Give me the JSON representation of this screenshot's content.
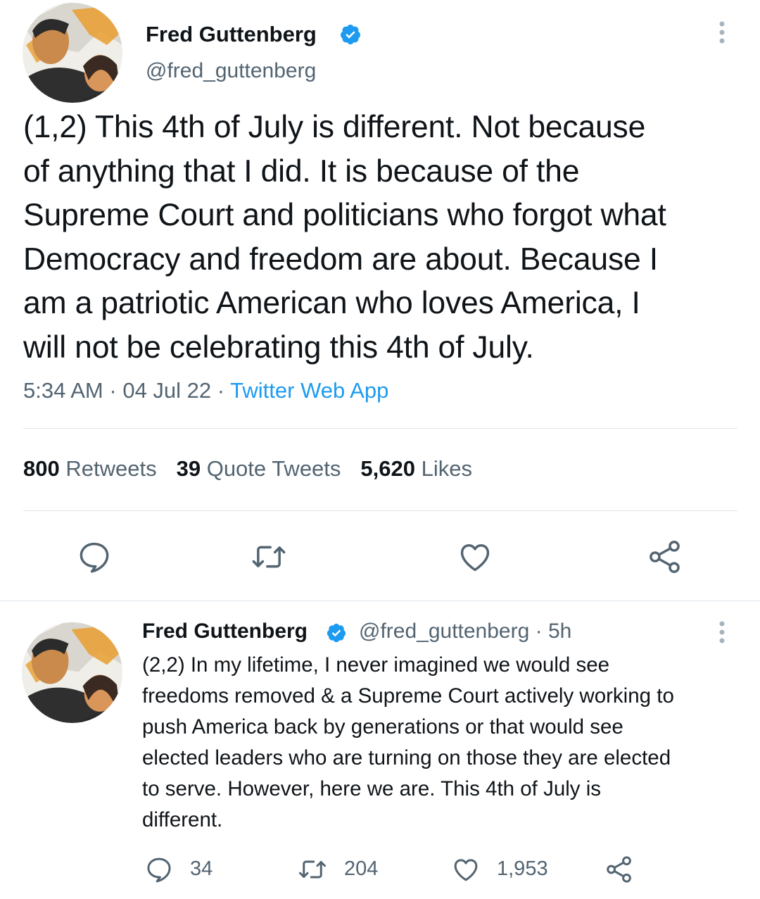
{
  "main_tweet": {
    "author": {
      "name": "Fred Guttenberg",
      "handle": "@fred_guttenberg",
      "verified": true
    },
    "text": "(1,2) This 4th of July is different.  Not because\nof anything that I did. It is because of the\nSupreme Court and politicians who forgot what\nDemocracy and freedom are about.  Because I\nam a patriotic American who loves America, I\nwill not be celebrating this 4th of July.",
    "time": "5:34 AM",
    "date": "04 Jul 22",
    "source": "Twitter Web App",
    "separator": "·",
    "stats": {
      "retweets_count": "800",
      "retweets_label": "Retweets",
      "quotes_count": "39",
      "quotes_label": "Quote Tweets",
      "likes_count": "5,620",
      "likes_label": "Likes"
    },
    "actions": [
      "reply-icon",
      "retweet-icon",
      "like-icon",
      "share-icon"
    ]
  },
  "reply_tweet": {
    "author": {
      "name": "Fred Guttenberg",
      "handle": "@fred_guttenberg",
      "verified": true
    },
    "age": "· 5h",
    "text": "(2,2) In my lifetime, I never imagined we would see\nfreedoms removed & a Supreme Court actively working to\npush America back by generations or that would see\nelected leaders who are turning on those they are elected\nto serve.  However, here we are.  This 4th of July is\ndifferent.",
    "counts": {
      "replies": "34",
      "retweets": "204",
      "likes": "1,953"
    }
  },
  "colors": {
    "text_primary": "#0f1419",
    "text_secondary": "#536471",
    "accent": "#1d9bf0",
    "divider": "#e1e6ea"
  }
}
